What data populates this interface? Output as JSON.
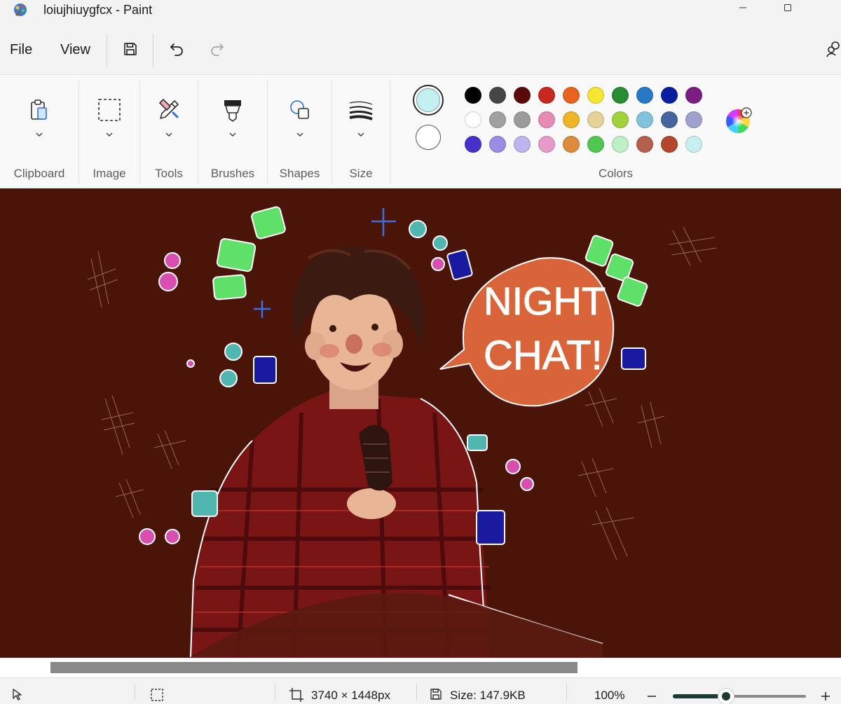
{
  "window": {
    "title": "loiujhiuygfcx - Paint"
  },
  "menu": {
    "file": "File",
    "view": "View"
  },
  "ribbon": {
    "groups": [
      "Clipboard",
      "Image",
      "Tools",
      "Brushes",
      "Shapes",
      "Size"
    ],
    "colors_label": "Colors"
  },
  "colors": {
    "primary": "#c5f0f2",
    "secondary": "#ffffff",
    "palette": [
      [
        "#000000",
        "#464646",
        "#5a0a0a",
        "#c8281e",
        "#e8641e",
        "#f5e632",
        "#288c32",
        "#2878c8",
        "#0a1ea0",
        "#7a1e82"
      ],
      [
        "#ffffff",
        "#a0a0a0",
        "#9b9b9b",
        "#e68cb4",
        "#f0b428",
        "#e6d296",
        "#a0d23c",
        "#82c3dc",
        "#4664a0",
        "#a0a0cd"
      ],
      [
        "#4632c8",
        "#9b8ce6",
        "#beb4f0",
        "#e69bc8",
        "#dc8c3c",
        "#50c850",
        "#bef0c8",
        "#b4604a",
        "#b4462d",
        "#c8f0f0"
      ]
    ]
  },
  "artwork": {
    "bubble_text_1": "NIGHT",
    "bubble_text_2": "CHAT!"
  },
  "status": {
    "dimensions": "3740 × 1448px",
    "size": "Size: 147.9KB",
    "zoom": "100%",
    "zoom_level": 0.4
  }
}
